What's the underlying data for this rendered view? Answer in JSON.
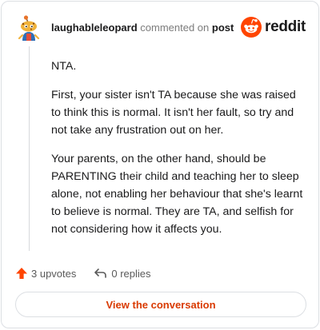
{
  "header": {
    "username": "laughableleopard",
    "verb": "commented on",
    "post_link": "post",
    "brand": "reddit",
    "brand_color": "#ff4500"
  },
  "comment": {
    "paragraphs": [
      "NTA.",
      "First, your sister isn't TA because she was raised to think this is normal. It isn't her fault, so try and not take any frustration out on her.",
      "Your parents, on the other hand, should be PARENTING their child and teaching her to sleep alone, not enabling her behaviour that she's learnt to believe is normal. They are TA, and selfish for not considering how it affects you."
    ]
  },
  "actions": {
    "upvotes": "3 upvotes",
    "replies": "0 replies",
    "upvote_color": "#ff4500"
  },
  "footer": {
    "view_conversation": "View the conversation",
    "accent": "#d93a00"
  }
}
